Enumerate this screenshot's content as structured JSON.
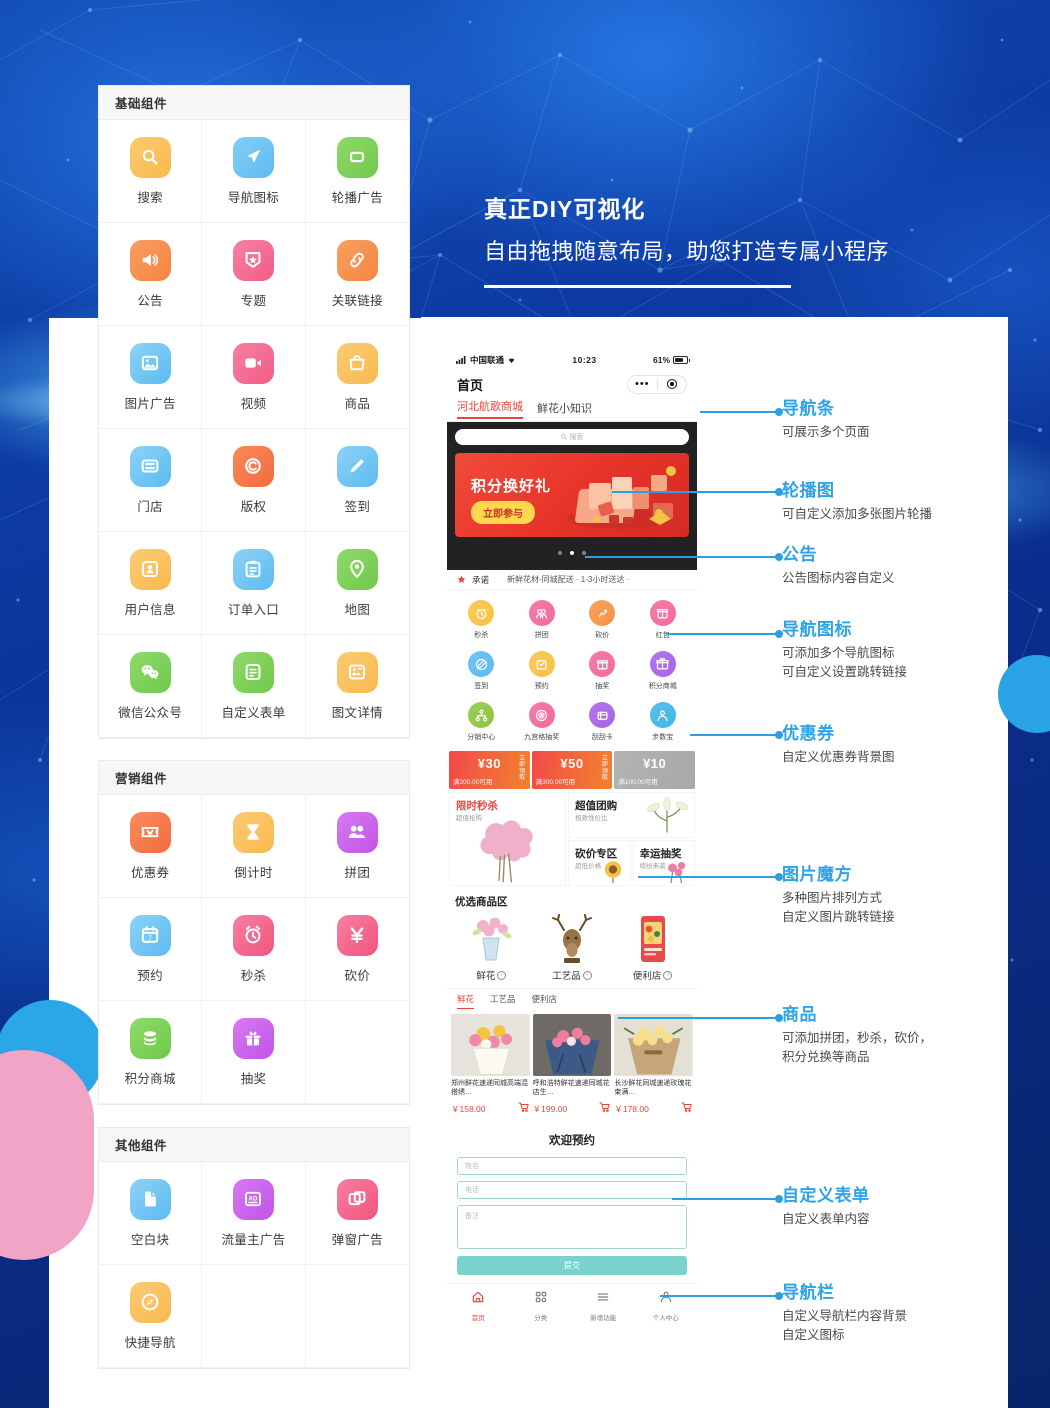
{
  "headline": {
    "line1": "真正DIY可视化",
    "line2": "自由拖拽随意布局，助您打造专属小程序"
  },
  "component_panels": [
    {
      "title": "基础组件",
      "items": [
        {
          "label": "搜索",
          "icon": "search-icon",
          "color": "#F9B94E",
          "color2": "#FBCB6E"
        },
        {
          "label": "导航图标",
          "icon": "navigation-icon",
          "color": "#5BBBF0",
          "color2": "#85CEF5"
        },
        {
          "label": "轮播广告",
          "icon": "carousel-icon",
          "color": "#6FC94A",
          "color2": "#8FD96B"
        },
        {
          "label": "公告",
          "icon": "megaphone-icon",
          "color": "#F58440",
          "color2": "#F99E61"
        },
        {
          "label": "专题",
          "icon": "star-badge-icon",
          "color": "#F25D86",
          "color2": "#F681A2"
        },
        {
          "label": "关联链接",
          "icon": "link-icon",
          "color": "#F58440",
          "color2": "#F9A061"
        },
        {
          "label": "图片广告",
          "icon": "image-icon",
          "color": "#5BBBF0",
          "color2": "#8ED2F7"
        },
        {
          "label": "视频",
          "icon": "video-icon",
          "color": "#F25D86",
          "color2": "#F77FA3"
        },
        {
          "label": "商品",
          "icon": "bag-icon",
          "color": "#F9B94E",
          "color2": "#FBCB74"
        },
        {
          "label": "门店",
          "icon": "store-icon",
          "color": "#5BBBF0",
          "color2": "#8ED2F7"
        },
        {
          "label": "版权",
          "icon": "copyright-icon",
          "color": "#F26B3A",
          "color2": "#F78A5C"
        },
        {
          "label": "签到",
          "icon": "pencil-icon",
          "color": "#5BBBF0",
          "color2": "#8ED2F7"
        },
        {
          "label": "用户信息",
          "icon": "user-card-icon",
          "color": "#F9B94E",
          "color2": "#FBCB74"
        },
        {
          "label": "订单入口",
          "icon": "clipboard-icon",
          "color": "#5BBBF0",
          "color2": "#8ED2F7"
        },
        {
          "label": "地图",
          "icon": "map-pin-icon",
          "color": "#6FC94A",
          "color2": "#8FD96B"
        },
        {
          "label": "微信公众号",
          "icon": "wechat-icon",
          "color": "#6FC94A",
          "color2": "#8FD96B"
        },
        {
          "label": "自定义表单",
          "icon": "form-icon",
          "color": "#6FC94A",
          "color2": "#8FD96B"
        },
        {
          "label": "图文详情",
          "icon": "article-icon",
          "color": "#F9B94E",
          "color2": "#FBCB74"
        }
      ]
    },
    {
      "title": "营销组件",
      "items": [
        {
          "label": "优惠券",
          "icon": "coupon-icon",
          "color": "#F36C3D",
          "color2": "#F78C5F"
        },
        {
          "label": "倒计时",
          "icon": "hourglass-icon",
          "color": "#F9B94E",
          "color2": "#FBCB74"
        },
        {
          "label": "拼团",
          "icon": "group-icon",
          "color": "#C252E8",
          "color2": "#D67BF2"
        },
        {
          "label": "预约",
          "icon": "calendar-icon",
          "color": "#5BBBF0",
          "color2": "#8ED2F7"
        },
        {
          "label": "秒杀",
          "icon": "alarm-icon",
          "color": "#F2557E",
          "color2": "#F77FA0"
        },
        {
          "label": "砍价",
          "icon": "yuan-icon",
          "color": "#F2557E",
          "color2": "#F77FA0"
        },
        {
          "label": "积分商城",
          "icon": "coins-icon",
          "color": "#6FC94A",
          "color2": "#8FD96B"
        },
        {
          "label": "抽奖",
          "icon": "gift-icon",
          "color": "#C252E8",
          "color2": "#D67BF2"
        },
        {
          "label": "",
          "icon": "",
          "color": "",
          "color2": ""
        }
      ]
    },
    {
      "title": "其他组件",
      "items": [
        {
          "label": "空白块",
          "icon": "blank-page-icon",
          "color": "#5BBBF0",
          "color2": "#8ED2F7"
        },
        {
          "label": "流量主广告",
          "icon": "ad-icon",
          "color": "#C252E8",
          "color2": "#D67BF2"
        },
        {
          "label": "弹窗广告",
          "icon": "popup-icon",
          "color": "#F2557E",
          "color2": "#F77FA0"
        },
        {
          "label": "快捷导航",
          "icon": "compass-icon",
          "color": "#F9B94E",
          "color2": "#FBCB74"
        },
        {
          "label": "",
          "icon": "",
          "color": "",
          "color2": ""
        },
        {
          "label": "",
          "icon": "",
          "color": "",
          "color2": ""
        }
      ]
    }
  ],
  "phone": {
    "status": {
      "carrier": "中国联通",
      "time": "10:23",
      "battery": "61%"
    },
    "nav_title": "首页",
    "tabs": [
      {
        "label": "河北航歌商城",
        "active": true
      },
      {
        "label": "鲜花小知识",
        "active": false
      }
    ],
    "search_placeholder": "搜索",
    "banner": {
      "title": "积分换好礼",
      "button": "立即参与"
    },
    "notice": {
      "tag": "承诺",
      "text": "新鲜花材-同城配送 · 1-3小时送达 ·"
    },
    "nav_icons": [
      {
        "label": "秒杀",
        "color": "#F6C243"
      },
      {
        "label": "拼团",
        "color": "#F2699B"
      },
      {
        "label": "砍价",
        "color": "#F79344"
      },
      {
        "label": "红包",
        "color": "#F2699B"
      },
      {
        "label": "签到",
        "color": "#5BBBF0"
      },
      {
        "label": "预约",
        "color": "#F6C243"
      },
      {
        "label": "抽奖",
        "color": "#F2699B"
      },
      {
        "label": "积分商城",
        "color": "#A862E8"
      },
      {
        "label": "分销中心",
        "color": "#8CC63F"
      },
      {
        "label": "九宫格抽奖",
        "color": "#F2699B"
      },
      {
        "label": "刮刮卡",
        "color": "#A862E8"
      },
      {
        "label": "步数宝",
        "color": "#3FB6E8"
      }
    ],
    "coupons": [
      {
        "amount": "¥30",
        "condition": "满200.00可用",
        "get": "立即领取",
        "active": true
      },
      {
        "amount": "¥50",
        "condition": "满300.00可用",
        "get": "立即领取",
        "active": true
      },
      {
        "amount": "¥10",
        "condition": "满100.00可用",
        "get": "",
        "active": false
      }
    ],
    "cube": [
      {
        "title": "限时秒杀",
        "sub": "超值抢购"
      },
      {
        "title": "超值团购",
        "sub": "极致性价比"
      },
      {
        "title": "砍价专区",
        "sub": "超低价格"
      },
      {
        "title": "幸运抽奖",
        "sub": "缤纷来袭"
      }
    ],
    "goods_zone": {
      "title": "优选商品区",
      "items": [
        {
          "label": "鲜花"
        },
        {
          "label": "工艺品"
        },
        {
          "label": "便利店"
        }
      ],
      "tabs": [
        {
          "label": "鲜花",
          "active": true
        },
        {
          "label": "工艺品",
          "active": false
        },
        {
          "label": "便利店",
          "active": false
        }
      ]
    },
    "products": [
      {
        "name": "郑州鲜花速递同城高端混搭绣…",
        "price": "￥158.00"
      },
      {
        "name": "呼和浩特鲜花速递同城花店生…",
        "price": "￥199.00"
      },
      {
        "name": "长沙鲜花同城速递玫瑰花束满…",
        "price": "￥178.00"
      }
    ],
    "form": {
      "title": "欢迎预约",
      "name_placeholder": "姓名",
      "phone_placeholder": "电话",
      "note_placeholder": "备注",
      "submit": "提交"
    },
    "tabbar": [
      {
        "label": "首页",
        "icon": "home-icon",
        "active": true
      },
      {
        "label": "分类",
        "icon": "grid-icon",
        "active": false
      },
      {
        "label": "新增功能",
        "icon": "menu-icon",
        "active": false
      },
      {
        "label": "个人中心",
        "icon": "person-icon",
        "active": false
      }
    ]
  },
  "annotations": [
    {
      "title": "导航条",
      "desc": "可展示多个页面"
    },
    {
      "title": "轮播图",
      "desc": "可自定义添加多张图片轮播"
    },
    {
      "title": "公告",
      "desc": "公告图标内容自定义"
    },
    {
      "title": "导航图标",
      "desc": "可添加多个导航图标\n可自定义设置跳转链接"
    },
    {
      "title": "优惠券",
      "desc": "自定义优惠券背景图"
    },
    {
      "title": "图片魔方",
      "desc": "多种图片排列方式\n自定义图片跳转链接"
    },
    {
      "title": "商品",
      "desc": "可添加拼团，秒杀，砍价，\n积分兑换等商品"
    },
    {
      "title": "自定义表单",
      "desc": "自定义表单内容"
    },
    {
      "title": "导航栏",
      "desc": "自定义导航栏内容背景\n自定义图标"
    }
  ],
  "colors": {
    "accent": "#2DA3E9",
    "bg_blue": "#0a2d8c",
    "pink_blob": "#F2A4C6",
    "blue_blob": "#2BA7E8",
    "red": "#e8453c",
    "teal": "#79d2cc"
  }
}
